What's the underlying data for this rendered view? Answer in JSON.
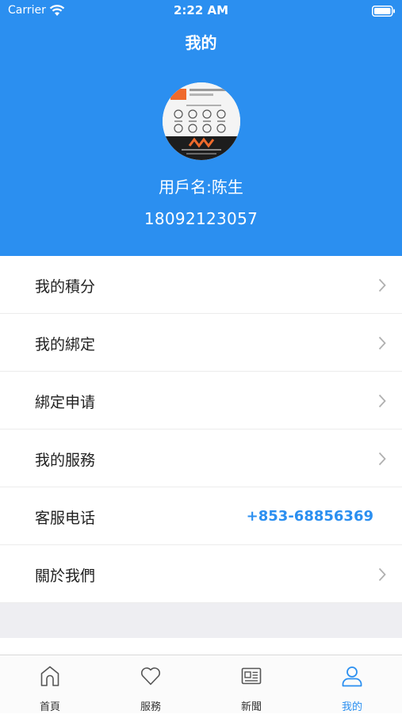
{
  "status_bar": {
    "carrier": "Carrier",
    "time": "2:22 AM"
  },
  "header": {
    "title": "我的",
    "username": "用戶名:陈生",
    "phone": "18092123057",
    "bg_color": "#2b8ff0"
  },
  "menu": {
    "items": [
      {
        "label": "我的積分"
      },
      {
        "label": "我的綁定"
      },
      {
        "label": "綁定申请"
      },
      {
        "label": "我的服務"
      },
      {
        "label": "客服电话",
        "value": "+853-68856369"
      },
      {
        "label": "關於我們"
      }
    ]
  },
  "tabbar": {
    "items": [
      {
        "label": "首頁",
        "icon": "home-icon"
      },
      {
        "label": "服務",
        "icon": "heart-icon"
      },
      {
        "label": "新聞",
        "icon": "newspaper-icon"
      },
      {
        "label": "我的",
        "icon": "person-icon",
        "active": true
      }
    ],
    "active_color": "#2b8ff0"
  }
}
